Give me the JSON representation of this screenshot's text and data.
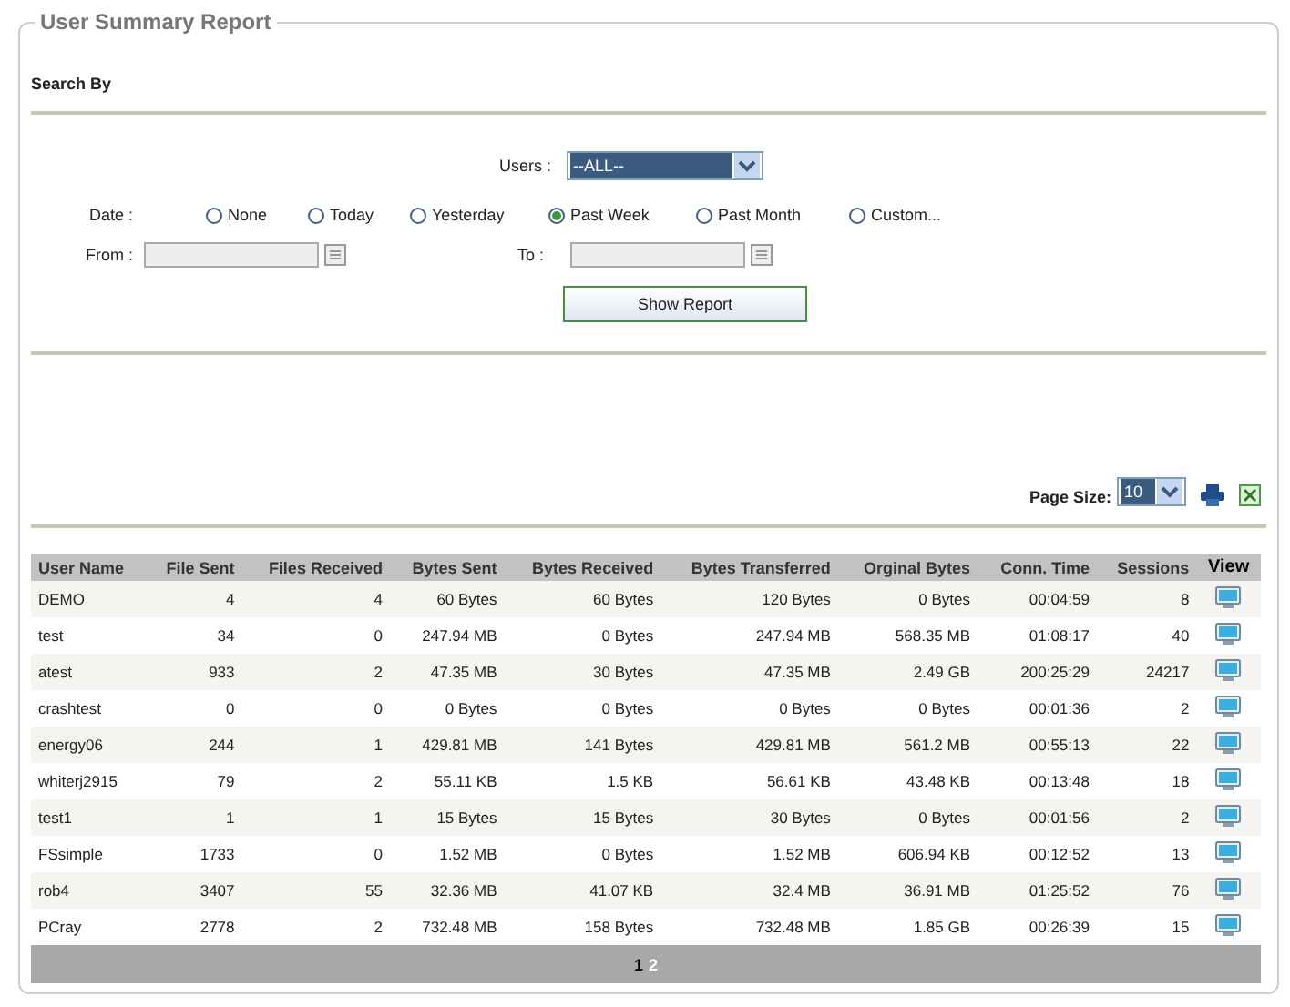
{
  "title": "User Summary Report",
  "search": {
    "heading": "Search By",
    "users": {
      "label": "Users :",
      "value": "--ALL--"
    },
    "date": {
      "label": "Date :",
      "options": [
        {
          "label": "None",
          "selected": false
        },
        {
          "label": "Today",
          "selected": false
        },
        {
          "label": "Yesterday",
          "selected": false
        },
        {
          "label": "Past Week",
          "selected": true
        },
        {
          "label": "Past Month",
          "selected": false
        },
        {
          "label": "Custom...",
          "selected": false
        }
      ]
    },
    "from": {
      "label": "From :",
      "disabled": true
    },
    "to": {
      "label": "To :",
      "disabled": true
    },
    "button": "Show Report"
  },
  "page_size": {
    "label": "Page Size:",
    "value": "10"
  },
  "table": {
    "columns": [
      "User Name",
      "File Sent",
      "Files Received",
      "Bytes Sent",
      "Bytes Received",
      "Bytes Transferred",
      "Orginal Bytes",
      "Conn. Time",
      "Sessions",
      "View"
    ],
    "rows": [
      [
        "DEMO",
        "4",
        "4",
        "60 Bytes",
        "60 Bytes",
        "120 Bytes",
        "0 Bytes",
        "00:04:59",
        "8"
      ],
      [
        "test",
        "34",
        "0",
        "247.94 MB",
        "0 Bytes",
        "247.94 MB",
        "568.35 MB",
        "01:08:17",
        "40"
      ],
      [
        "atest",
        "933",
        "2",
        "47.35 MB",
        "30 Bytes",
        "47.35 MB",
        "2.49 GB",
        "200:25:29",
        "24217"
      ],
      [
        "crashtest",
        "0",
        "0",
        "0 Bytes",
        "0 Bytes",
        "0 Bytes",
        "0 Bytes",
        "00:01:36",
        "2"
      ],
      [
        "energy06",
        "244",
        "1",
        "429.81 MB",
        "141 Bytes",
        "429.81 MB",
        "561.2 MB",
        "00:55:13",
        "22"
      ],
      [
        "whiterj2915",
        "79",
        "2",
        "55.11 KB",
        "1.5 KB",
        "56.61 KB",
        "43.48 KB",
        "00:13:48",
        "18"
      ],
      [
        "test1",
        "1",
        "1",
        "15 Bytes",
        "15 Bytes",
        "30 Bytes",
        "0 Bytes",
        "00:01:56",
        "2"
      ],
      [
        "FSsimple",
        "1733",
        "0",
        "1.52 MB",
        "0 Bytes",
        "1.52 MB",
        "606.94 KB",
        "00:12:52",
        "13"
      ],
      [
        "rob4",
        "3407",
        "55",
        "32.36 MB",
        "41.07 KB",
        "32.4 MB",
        "36.91 MB",
        "01:25:52",
        "76"
      ],
      [
        "PCray",
        "2778",
        "2",
        "732.48 MB",
        "158 Bytes",
        "732.48 MB",
        "1.85 GB",
        "00:26:39",
        "15"
      ]
    ]
  },
  "pagination": [
    {
      "label": "1",
      "selected": true
    },
    {
      "label": "2",
      "selected": false
    }
  ]
}
